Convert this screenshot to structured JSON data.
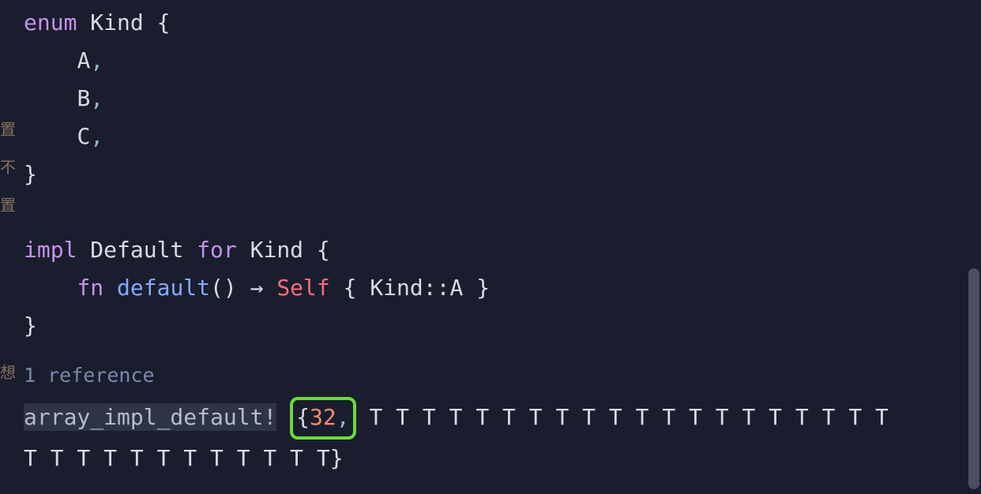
{
  "code": {
    "enum_kw": "enum",
    "enum_name": "Kind",
    "variant_a": "A",
    "variant_b": "B",
    "variant_c": "C",
    "impl_kw": "impl",
    "trait_name": "Default",
    "for_kw": "for",
    "impl_type": "Kind",
    "fn_kw": "fn",
    "fn_name": "default",
    "parens": "()",
    "arrow": "→",
    "self_kw": "Self",
    "ret_expr_type": "Kind",
    "ret_expr_sep": "::",
    "ret_expr_variant": "A",
    "open_brace": "{",
    "close_brace": "}",
    "comma": ","
  },
  "codelens": {
    "text": "1 reference"
  },
  "macro": {
    "name": "array_impl_default!",
    "count": "32",
    "generics1": "T T T T T T T T T T T T T T T T T T T T",
    "generics2": "T T T T T T T T T T T T"
  },
  "gutter": {
    "h1": "",
    "h2": "",
    "h3": "置",
    "h4": "不",
    "h5": "置",
    "h6": "",
    "h7": "",
    "h8": "想",
    "h9": ""
  }
}
